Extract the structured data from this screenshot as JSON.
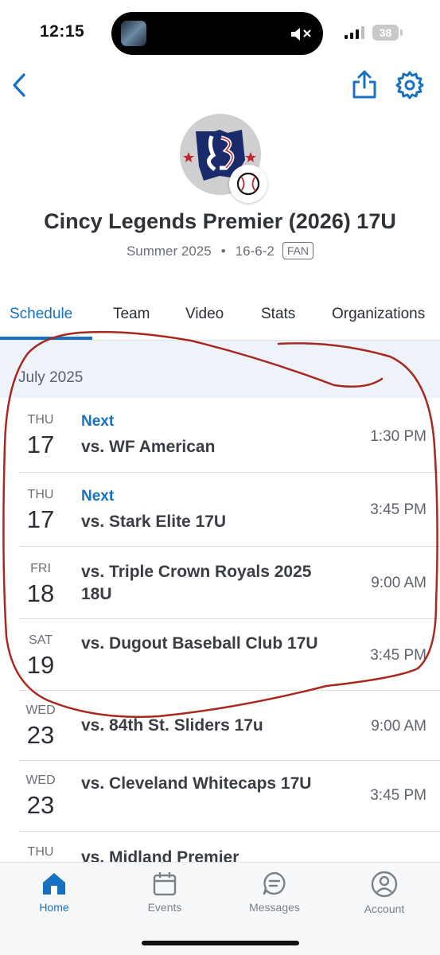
{
  "status_bar": {
    "time": "12:15",
    "battery": "38"
  },
  "team": {
    "name": "Cincy Legends Premier (2026) 17U",
    "season": "Summer 2025",
    "record": "16-6-2",
    "badge": "FAN"
  },
  "tabs": [
    {
      "label": "Schedule",
      "active": true
    },
    {
      "label": "Team"
    },
    {
      "label": "Video"
    },
    {
      "label": "Stats"
    },
    {
      "label": "Organizations"
    }
  ],
  "schedule": {
    "month": "July 2025",
    "games": [
      {
        "dow": "THU",
        "day": "17",
        "tag": "Next",
        "opponent": "vs. WF American",
        "time": "1:30 PM"
      },
      {
        "dow": "THU",
        "day": "17",
        "tag": "Next",
        "opponent": "vs. Stark Elite 17U",
        "time": "3:45 PM"
      },
      {
        "dow": "FRI",
        "day": "18",
        "opponent": "vs. Triple Crown Royals 2025 18U",
        "time": "9:00 AM"
      },
      {
        "dow": "SAT",
        "day": "19",
        "opponent": "vs. Dugout Baseball Club 17U",
        "time": "3:45 PM"
      },
      {
        "dow": "WED",
        "day": "23",
        "opponent": "vs. 84th St. Sliders 17u",
        "time": "9:00 AM"
      },
      {
        "dow": "WED",
        "day": "23",
        "opponent": "vs. Cleveland Whitecaps 17U",
        "time": "3:45 PM"
      },
      {
        "dow": "THU",
        "day": "",
        "opponent": "vs. Midland Premier",
        "time": ""
      }
    ]
  },
  "bottom_nav": [
    {
      "label": "Home",
      "icon": "home-icon",
      "active": true
    },
    {
      "label": "Events",
      "icon": "calendar-icon"
    },
    {
      "label": "Messages",
      "icon": "chat-icon"
    },
    {
      "label": "Account",
      "icon": "person-icon"
    }
  ],
  "colors": {
    "accent": "#1870c0",
    "annotation": "#a8271e",
    "month_bg": "#eef2f9"
  }
}
